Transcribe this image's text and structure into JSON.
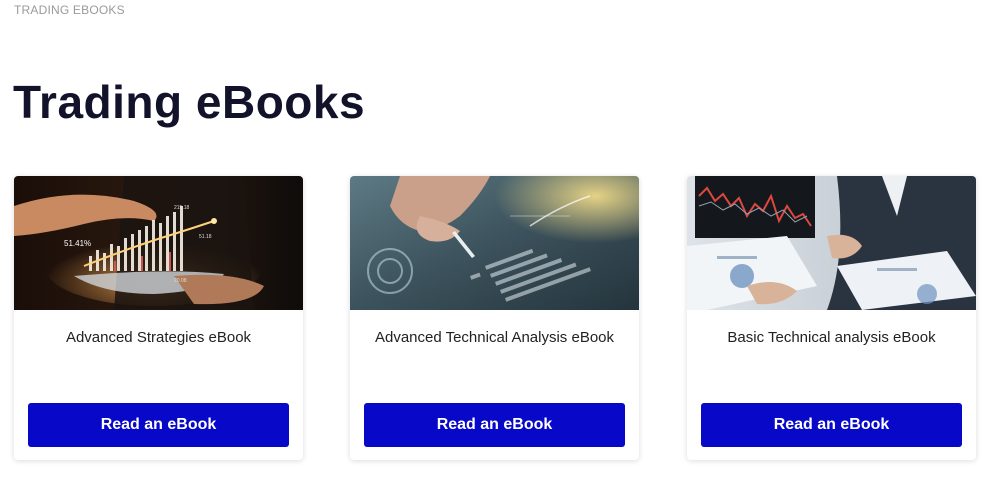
{
  "breadcrumb": "TRADING EBOOKS",
  "page_title": "Trading eBooks",
  "colors": {
    "accent": "#0808c8",
    "title": "#12132a",
    "breadcrumb": "#9a9a9a"
  },
  "cards": [
    {
      "image": "trading-chart-tablet-photo",
      "title": "Advanced Strategies eBook",
      "button_label": "Read an eBook",
      "image_text": {
        "percent": "51.41%",
        "value_a": "215.18",
        "value_b": "51.18",
        "value_c": "20.08"
      }
    },
    {
      "image": "hand-with-pen-analysis-photo",
      "title": "Advanced Technical Analysis eBook",
      "button_label": "Read an eBook"
    },
    {
      "image": "business-meeting-charts-photo",
      "title": "Basic Technical analysis eBook",
      "button_label": "Read an eBook"
    }
  ]
}
